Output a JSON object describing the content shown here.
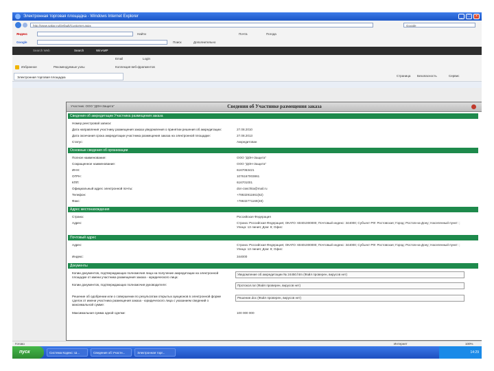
{
  "window": {
    "title": "Электронная торговая площадка - Windows Internet Explorer"
  },
  "address": {
    "url": "http://www.sakar.ru/Default/Customer.aspx",
    "search_placeholder": "Google"
  },
  "toolbar_yandex": {
    "brand": "Яндекс",
    "items": [
      "Найти",
      "Почта",
      "Погода"
    ]
  },
  "toolbar_google": {
    "brand": "Google",
    "items": [
      "Поиск",
      "Дополнительно"
    ]
  },
  "toolbar_search": {
    "items": [
      "Search Web",
      "Search",
      "WinAMP",
      "Email",
      "Login"
    ]
  },
  "favorites": {
    "label": "Избранное",
    "items": [
      "Рекомендуемые узлы",
      "Коллекция веб-фрагментов"
    ]
  },
  "tab": {
    "label": "Электронная торговая площадка",
    "commands": [
      "Страница",
      "Безопасность",
      "Сервис"
    ]
  },
  "dialog": {
    "small_title": "Участник: ООО \"ДОН-Защита\"",
    "title": "Сведения об Участнике размещения заказа",
    "sections": [
      {
        "header": "Сведения об аккредитации Участника размещения заказа",
        "rows": [
          {
            "label": "Номер реестровой записи:",
            "value": ""
          },
          {
            "label": "Дата направления участнику размещения заказа уведомления о принятии решения об аккредитации:",
            "value": "27.08.2010"
          },
          {
            "label": "Дата окончания срока аккредитации участника размещения заказа на электронной площадке:",
            "value": "27.08.2013"
          },
          {
            "label": "Статус:",
            "value": "Аккредитован"
          }
        ]
      },
      {
        "header": "Основные сведения об организации",
        "rows": [
          {
            "label": "Полное наименование:",
            "value": "ООО \"ДОН-Защита\""
          },
          {
            "label": "Сокращенное наименование:",
            "value": "ООО \"ДОН-Защита\""
          },
          {
            "label": "ИНН:",
            "value": "6167063421"
          },
          {
            "label": "ОГРН:",
            "value": "1076167003861"
          },
          {
            "label": "КПП:",
            "value": "616701001"
          },
          {
            "label": "Официальный адрес электронной почты:",
            "value": "don-zaschita@mail.ru"
          },
          {
            "label": "Телефон:",
            "value": "+78632911661(62)"
          },
          {
            "label": "Факс:",
            "value": "+78632771169(48)"
          }
        ]
      },
      {
        "header": "Адрес местонахождения",
        "rows": [
          {
            "label": "Страна:",
            "value": "Российская Федерация"
          },
          {
            "label": "Адрес:",
            "value": "Страна: Российская Федерация; ОКАТО: 60401000000; Почтовый индекс: 344000; Субъект РФ: Ростовская; Город: Ростов-на-Дону; Населенный пункт: ; Улица: 13 линия; Дом: 8; Офис:"
          }
        ]
      },
      {
        "header": "Почтовый адрес",
        "rows": [
          {
            "label": "Адрес:",
            "value": "Страна: Российская Федерация; ОКАТО: 60401000000; Почтовый индекс: 344000; Субъект РФ: Ростовская; Город: Ростов-на-Дону; Населенный пункт: ; Улица: 13 линия; Дом: 8; Офис:"
          },
          {
            "label": "Индекс:",
            "value": "344000"
          }
        ]
      },
      {
        "header": "Документы",
        "rows": [
          {
            "label": "Копии документов, подтверждающих полномочия лица на получение аккредитации на электронной площадке от имени участника размещения заказа - юридического лица:",
            "value": "Уведомление об аккредитации № 24450.htm (Файл проверен, вирусов нет)"
          },
          {
            "label": "Копии документов, подтверждающих полномочия руководителя:",
            "value": "Протокол.rar (Файл проверен, вирусов нет)"
          },
          {
            "label": "Решение об одобрении или о совершении по результатам открытых аукционов в электронной форме сделок от имени участника размещения заказа - юридического лица с указанием сведений о максимальной сумме:",
            "value": "Решение.doc (Файл проверен, вирусов нет)"
          },
          {
            "label": "Максимальная сумма одной сделки:",
            "value": "100 000 000"
          }
        ]
      }
    ]
  },
  "status": {
    "text": "Готово",
    "zone": "Интернет",
    "zoom": "100%"
  },
  "taskbar": {
    "start": "пуск",
    "tasks": [
      "Система Кодекс: Ш...",
      "Сведения об Участн...",
      "Электронная торг..."
    ],
    "clock": "14:29"
  }
}
